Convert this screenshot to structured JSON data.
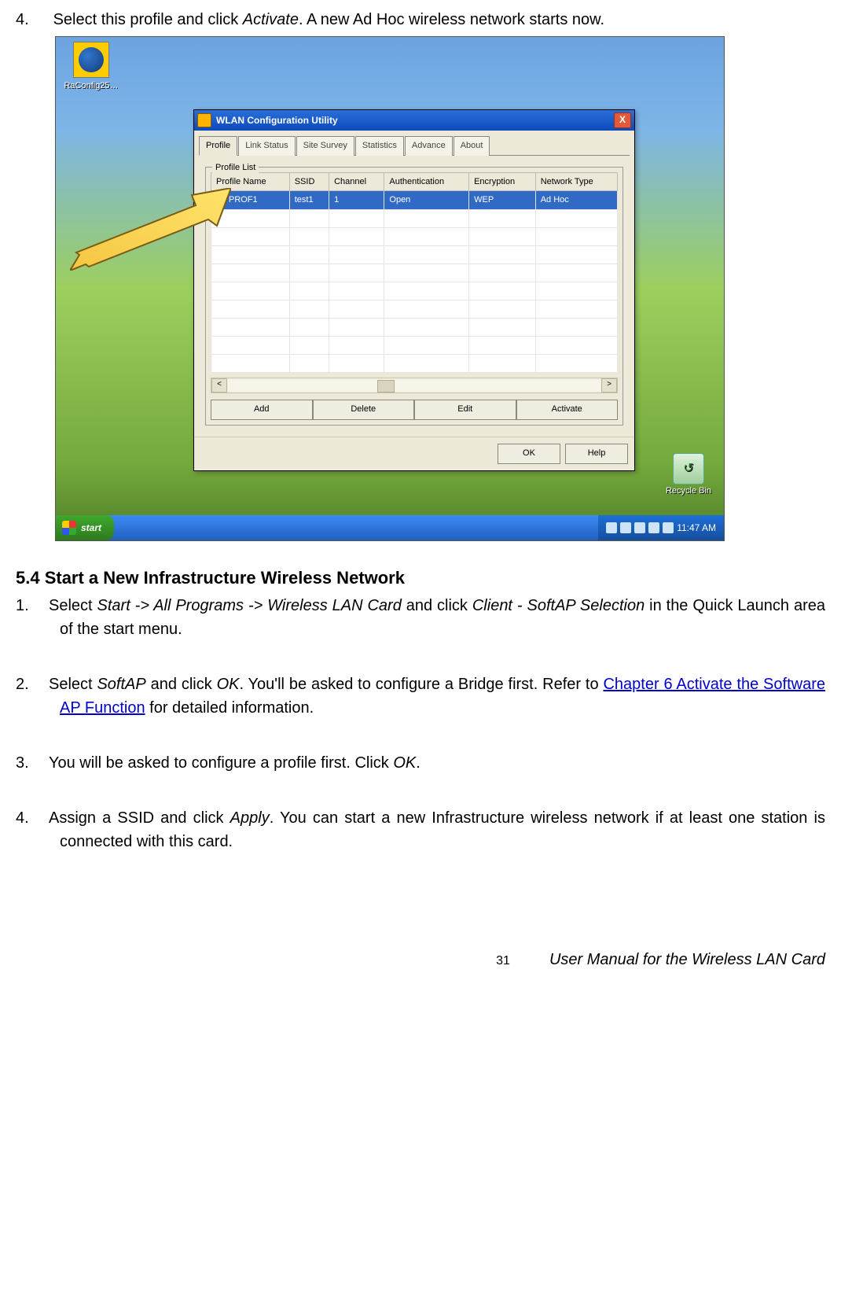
{
  "intro": {
    "num": "4.",
    "text_a": "Select this profile and click ",
    "activate": "Activate",
    "text_b": ". A new Ad Hoc wireless network starts now."
  },
  "desktop": {
    "icon_label": "RaConfig25…",
    "recycle_label": "Recycle Bin"
  },
  "window": {
    "title": "WLAN Configuration Utility",
    "close": "X",
    "tabs": [
      "Profile",
      "Link Status",
      "Site Survey",
      "Statistics",
      "Advance",
      "About"
    ],
    "group_label": "Profile List",
    "columns": [
      "Profile Name",
      "SSID",
      "Channel",
      "Authentication",
      "Encryption",
      "Network Type"
    ],
    "row": {
      "name": "PROF1",
      "ssid": "test1",
      "channel": "1",
      "auth": "Open",
      "enc": "WEP",
      "type": "Ad Hoc"
    },
    "buttons": [
      "Add",
      "Delete",
      "Edit",
      "Activate"
    ],
    "bottom": [
      "OK",
      "Help"
    ]
  },
  "taskbar": {
    "start": "start",
    "time": "11:47 AM"
  },
  "section_title": "5.4 Start a New Infrastructure Wireless Network",
  "steps": {
    "s1": {
      "n": "1.",
      "a": "Select ",
      "i1": "Start -> All Programs -> Wireless LAN Card",
      "b": " and click ",
      "i2": "Client - SoftAP Selection",
      "c": " in the Quick Launch area of the start menu."
    },
    "s2": {
      "n": "2.",
      "a": "Select ",
      "i1": "SoftAP",
      "b": " and click ",
      "i2": "OK",
      "c": ". You'll be asked to configure a Bridge first. Refer to ",
      "link": "Chapter 6 Activate the Software AP Function",
      "d": " for detailed information."
    },
    "s3": {
      "n": "3.",
      "a": "You will be asked to configure a profile first. Click ",
      "i1": "OK",
      "b": "."
    },
    "s4": {
      "n": "4.",
      "a": "Assign a SSID and click ",
      "i1": "Apply",
      "b": ". You can start a new Infrastructure wireless network if at least one station is connected with this card."
    }
  },
  "footer": {
    "page": "31",
    "title": "User Manual for the Wireless LAN Card"
  }
}
